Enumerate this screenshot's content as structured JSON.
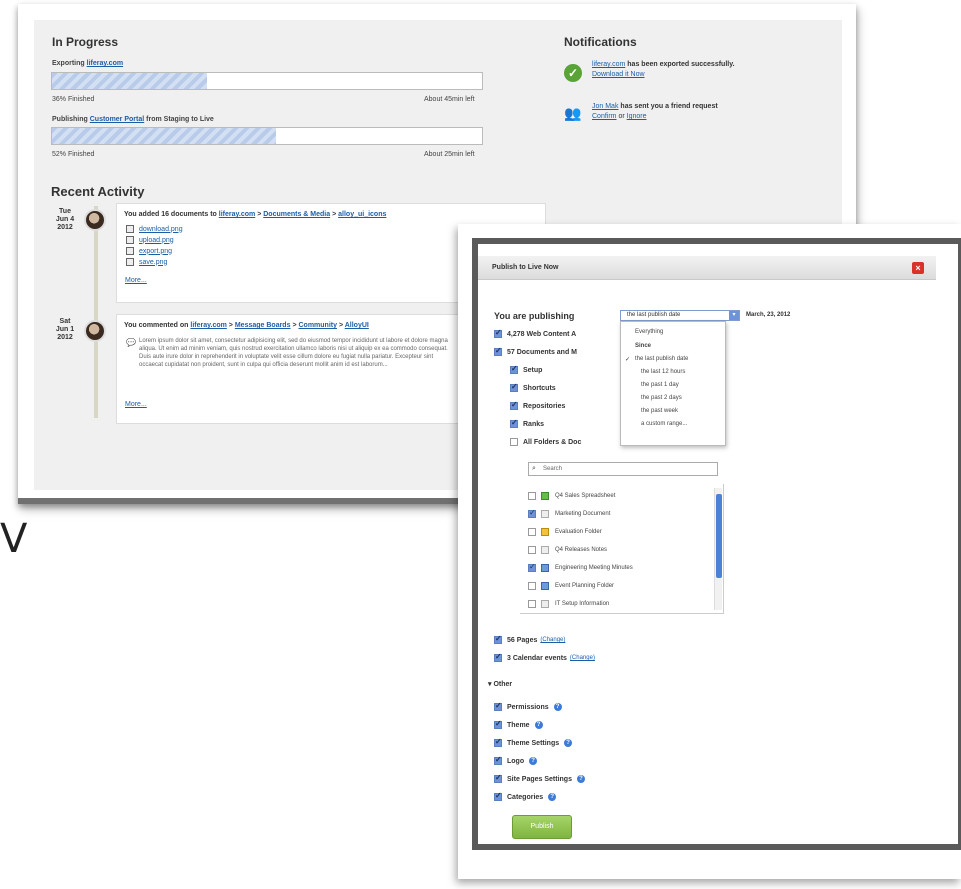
{
  "stray_char": "V",
  "in_progress": {
    "title": "In Progress",
    "items": [
      {
        "label_prefix": "Exporting",
        "link": "liferay.com",
        "label_suffix": "",
        "left": "36% Finished",
        "right": "About 45min left",
        "progress": 0.36
      },
      {
        "label_prefix": "Publishing",
        "link": "Customer Portal",
        "label_suffix": "from Staging to Live",
        "left": "52% Finished",
        "right": "About 25min left",
        "progress": 0.52
      }
    ]
  },
  "notifications": {
    "title": "Notifications",
    "items": [
      {
        "icon": "check-icon",
        "link": "liferay.com",
        "text": "has been exported successfully.",
        "action": "Download it Now",
        "action2": "",
        "connector": ""
      },
      {
        "icon": "people-icon",
        "link": "Jon Mak",
        "text": "has sent you a friend request",
        "action": "Confirm",
        "connector": "or",
        "action2": "Ignore"
      }
    ]
  },
  "recent_activity": {
    "title": "Recent Activity",
    "entries": [
      {
        "date": [
          "Tue",
          "Jun 4",
          "2012"
        ],
        "head_prefix": "You added 16 documents to",
        "crumbs": [
          "liferay.com",
          ">",
          "Documents & Media",
          ">",
          "alloy_ui_icons"
        ],
        "files": [
          "download.png",
          "upload.png",
          "export.png",
          "save.png"
        ],
        "more": "More..."
      },
      {
        "date": [
          "Sat",
          "Jun 1",
          "2012"
        ],
        "head_prefix": "You commented on",
        "crumbs": [
          "liferay.com",
          ">",
          "Message Boards",
          ">",
          "Community",
          ">",
          "AlloyUI"
        ],
        "lorem": "Lorem ipsum dolor sit amet, consectetur adipisicing elit, sed do eiusmod tempor incididunt ut labore et dolore magna aliqua. Ut enim ad minim veniam, quis nostrud exercitation ullamco laboris nisi ut aliquip ex ea commodo consequat. Duis aute irure dolor in reprehenderit in voluptate velit esse cillum dolore eu fugiat nulla pariatur. Excepteur sint occaecat cupidatat non proident, sunt in culpa qui officia deserunt mollit anim id est laborum...",
        "more": "More..."
      }
    ]
  },
  "dialog": {
    "title": "Publish to Live Now",
    "close": "×",
    "publishing_label": "You are publishing",
    "select_value": "the last publish date",
    "select_arrow": "▾",
    "date": "March, 23, 2012",
    "dropdown": {
      "items": [
        "Everything",
        "Since",
        "the last publish date",
        "the last 12 hours",
        "the past 1 day",
        "the past 2 days",
        "the past week",
        "a custom range..."
      ],
      "checked_index": 2,
      "checkmark": "✓"
    },
    "web_content": "4,278 Web Content A",
    "documents": "57 Documents and M",
    "doc_options": [
      {
        "label": "Setup",
        "checked": true
      },
      {
        "label": "Shortcuts",
        "checked": true
      },
      {
        "label": "Repositories",
        "checked": true
      },
      {
        "label": "Ranks",
        "checked": true
      },
      {
        "label": "All Folders & Doc",
        "checked": false
      }
    ],
    "search_placeholder": "Search",
    "search_glyph": "⌕",
    "files": [
      {
        "name": "Q4 Sales Spreadsheet",
        "checked": false,
        "icon": "green"
      },
      {
        "name": "Marketing Document",
        "checked": true,
        "icon": "doc"
      },
      {
        "name": "Evaluation Folder",
        "checked": false,
        "icon": "folder"
      },
      {
        "name": "Q4 Releases Notes",
        "checked": false,
        "icon": "doc"
      },
      {
        "name": "Engineering Meeting Minutes",
        "checked": true,
        "icon": "blue"
      },
      {
        "name": "Event Planning Folder",
        "checked": false,
        "icon": "blue"
      },
      {
        "name": "IT Setup Information",
        "checked": false,
        "icon": "doc"
      }
    ],
    "pages": {
      "label": "56 Pages",
      "change": "(Change)"
    },
    "calendar": {
      "label": "3 Calendar events",
      "change": "(Change)"
    },
    "other_label": "▾ Other",
    "other_options": [
      {
        "label": "Permissions",
        "help": "?"
      },
      {
        "label": "Theme",
        "help": "?"
      },
      {
        "label": "Theme Settings",
        "help": "?"
      },
      {
        "label": "Logo",
        "help": "?"
      },
      {
        "label": "Site Pages Settings",
        "help": "?"
      },
      {
        "label": "Categories",
        "help": "?"
      }
    ],
    "publish_button": "Publish"
  },
  "colors": {
    "link": "#1a5ea8",
    "accent_green": "#7eb53e",
    "checkbox_blue": "#6d92d8",
    "close_red": "#d8322a"
  }
}
